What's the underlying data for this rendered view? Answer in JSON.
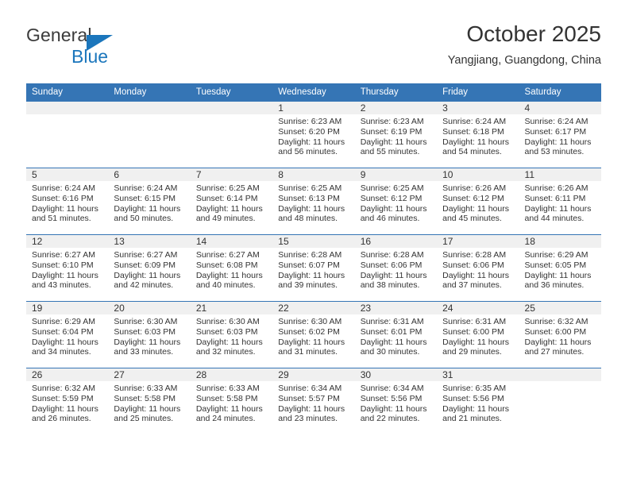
{
  "brand": {
    "line1": "General",
    "line2": "Blue",
    "triangle_color": "#1b76bc"
  },
  "header": {
    "title": "October 2025",
    "subtitle": "Yangjiang, Guangdong, China"
  },
  "theme": {
    "header_blue": "#3575b5",
    "band_gray": "#f0f0f0",
    "text": "#333333"
  },
  "calendar": {
    "weekday_headers": [
      "Sunday",
      "Monday",
      "Tuesday",
      "Wednesday",
      "Thursday",
      "Friday",
      "Saturday"
    ],
    "weeks": [
      [
        {
          "day": "",
          "sunrise": "",
          "sunset": "",
          "daylight1": "",
          "daylight2": ""
        },
        {
          "day": "",
          "sunrise": "",
          "sunset": "",
          "daylight1": "",
          "daylight2": ""
        },
        {
          "day": "",
          "sunrise": "",
          "sunset": "",
          "daylight1": "",
          "daylight2": ""
        },
        {
          "day": "1",
          "sunrise": "Sunrise: 6:23 AM",
          "sunset": "Sunset: 6:20 PM",
          "daylight1": "Daylight: 11 hours",
          "daylight2": "and 56 minutes."
        },
        {
          "day": "2",
          "sunrise": "Sunrise: 6:23 AM",
          "sunset": "Sunset: 6:19 PM",
          "daylight1": "Daylight: 11 hours",
          "daylight2": "and 55 minutes."
        },
        {
          "day": "3",
          "sunrise": "Sunrise: 6:24 AM",
          "sunset": "Sunset: 6:18 PM",
          "daylight1": "Daylight: 11 hours",
          "daylight2": "and 54 minutes."
        },
        {
          "day": "4",
          "sunrise": "Sunrise: 6:24 AM",
          "sunset": "Sunset: 6:17 PM",
          "daylight1": "Daylight: 11 hours",
          "daylight2": "and 53 minutes."
        }
      ],
      [
        {
          "day": "5",
          "sunrise": "Sunrise: 6:24 AM",
          "sunset": "Sunset: 6:16 PM",
          "daylight1": "Daylight: 11 hours",
          "daylight2": "and 51 minutes."
        },
        {
          "day": "6",
          "sunrise": "Sunrise: 6:24 AM",
          "sunset": "Sunset: 6:15 PM",
          "daylight1": "Daylight: 11 hours",
          "daylight2": "and 50 minutes."
        },
        {
          "day": "7",
          "sunrise": "Sunrise: 6:25 AM",
          "sunset": "Sunset: 6:14 PM",
          "daylight1": "Daylight: 11 hours",
          "daylight2": "and 49 minutes."
        },
        {
          "day": "8",
          "sunrise": "Sunrise: 6:25 AM",
          "sunset": "Sunset: 6:13 PM",
          "daylight1": "Daylight: 11 hours",
          "daylight2": "and 48 minutes."
        },
        {
          "day": "9",
          "sunrise": "Sunrise: 6:25 AM",
          "sunset": "Sunset: 6:12 PM",
          "daylight1": "Daylight: 11 hours",
          "daylight2": "and 46 minutes."
        },
        {
          "day": "10",
          "sunrise": "Sunrise: 6:26 AM",
          "sunset": "Sunset: 6:12 PM",
          "daylight1": "Daylight: 11 hours",
          "daylight2": "and 45 minutes."
        },
        {
          "day": "11",
          "sunrise": "Sunrise: 6:26 AM",
          "sunset": "Sunset: 6:11 PM",
          "daylight1": "Daylight: 11 hours",
          "daylight2": "and 44 minutes."
        }
      ],
      [
        {
          "day": "12",
          "sunrise": "Sunrise: 6:27 AM",
          "sunset": "Sunset: 6:10 PM",
          "daylight1": "Daylight: 11 hours",
          "daylight2": "and 43 minutes."
        },
        {
          "day": "13",
          "sunrise": "Sunrise: 6:27 AM",
          "sunset": "Sunset: 6:09 PM",
          "daylight1": "Daylight: 11 hours",
          "daylight2": "and 42 minutes."
        },
        {
          "day": "14",
          "sunrise": "Sunrise: 6:27 AM",
          "sunset": "Sunset: 6:08 PM",
          "daylight1": "Daylight: 11 hours",
          "daylight2": "and 40 minutes."
        },
        {
          "day": "15",
          "sunrise": "Sunrise: 6:28 AM",
          "sunset": "Sunset: 6:07 PM",
          "daylight1": "Daylight: 11 hours",
          "daylight2": "and 39 minutes."
        },
        {
          "day": "16",
          "sunrise": "Sunrise: 6:28 AM",
          "sunset": "Sunset: 6:06 PM",
          "daylight1": "Daylight: 11 hours",
          "daylight2": "and 38 minutes."
        },
        {
          "day": "17",
          "sunrise": "Sunrise: 6:28 AM",
          "sunset": "Sunset: 6:06 PM",
          "daylight1": "Daylight: 11 hours",
          "daylight2": "and 37 minutes."
        },
        {
          "day": "18",
          "sunrise": "Sunrise: 6:29 AM",
          "sunset": "Sunset: 6:05 PM",
          "daylight1": "Daylight: 11 hours",
          "daylight2": "and 36 minutes."
        }
      ],
      [
        {
          "day": "19",
          "sunrise": "Sunrise: 6:29 AM",
          "sunset": "Sunset: 6:04 PM",
          "daylight1": "Daylight: 11 hours",
          "daylight2": "and 34 minutes."
        },
        {
          "day": "20",
          "sunrise": "Sunrise: 6:30 AM",
          "sunset": "Sunset: 6:03 PM",
          "daylight1": "Daylight: 11 hours",
          "daylight2": "and 33 minutes."
        },
        {
          "day": "21",
          "sunrise": "Sunrise: 6:30 AM",
          "sunset": "Sunset: 6:03 PM",
          "daylight1": "Daylight: 11 hours",
          "daylight2": "and 32 minutes."
        },
        {
          "day": "22",
          "sunrise": "Sunrise: 6:30 AM",
          "sunset": "Sunset: 6:02 PM",
          "daylight1": "Daylight: 11 hours",
          "daylight2": "and 31 minutes."
        },
        {
          "day": "23",
          "sunrise": "Sunrise: 6:31 AM",
          "sunset": "Sunset: 6:01 PM",
          "daylight1": "Daylight: 11 hours",
          "daylight2": "and 30 minutes."
        },
        {
          "day": "24",
          "sunrise": "Sunrise: 6:31 AM",
          "sunset": "Sunset: 6:00 PM",
          "daylight1": "Daylight: 11 hours",
          "daylight2": "and 29 minutes."
        },
        {
          "day": "25",
          "sunrise": "Sunrise: 6:32 AM",
          "sunset": "Sunset: 6:00 PM",
          "daylight1": "Daylight: 11 hours",
          "daylight2": "and 27 minutes."
        }
      ],
      [
        {
          "day": "26",
          "sunrise": "Sunrise: 6:32 AM",
          "sunset": "Sunset: 5:59 PM",
          "daylight1": "Daylight: 11 hours",
          "daylight2": "and 26 minutes."
        },
        {
          "day": "27",
          "sunrise": "Sunrise: 6:33 AM",
          "sunset": "Sunset: 5:58 PM",
          "daylight1": "Daylight: 11 hours",
          "daylight2": "and 25 minutes."
        },
        {
          "day": "28",
          "sunrise": "Sunrise: 6:33 AM",
          "sunset": "Sunset: 5:58 PM",
          "daylight1": "Daylight: 11 hours",
          "daylight2": "and 24 minutes."
        },
        {
          "day": "29",
          "sunrise": "Sunrise: 6:34 AM",
          "sunset": "Sunset: 5:57 PM",
          "daylight1": "Daylight: 11 hours",
          "daylight2": "and 23 minutes."
        },
        {
          "day": "30",
          "sunrise": "Sunrise: 6:34 AM",
          "sunset": "Sunset: 5:56 PM",
          "daylight1": "Daylight: 11 hours",
          "daylight2": "and 22 minutes."
        },
        {
          "day": "31",
          "sunrise": "Sunrise: 6:35 AM",
          "sunset": "Sunset: 5:56 PM",
          "daylight1": "Daylight: 11 hours",
          "daylight2": "and 21 minutes."
        },
        {
          "day": "",
          "sunrise": "",
          "sunset": "",
          "daylight1": "",
          "daylight2": ""
        }
      ]
    ]
  }
}
